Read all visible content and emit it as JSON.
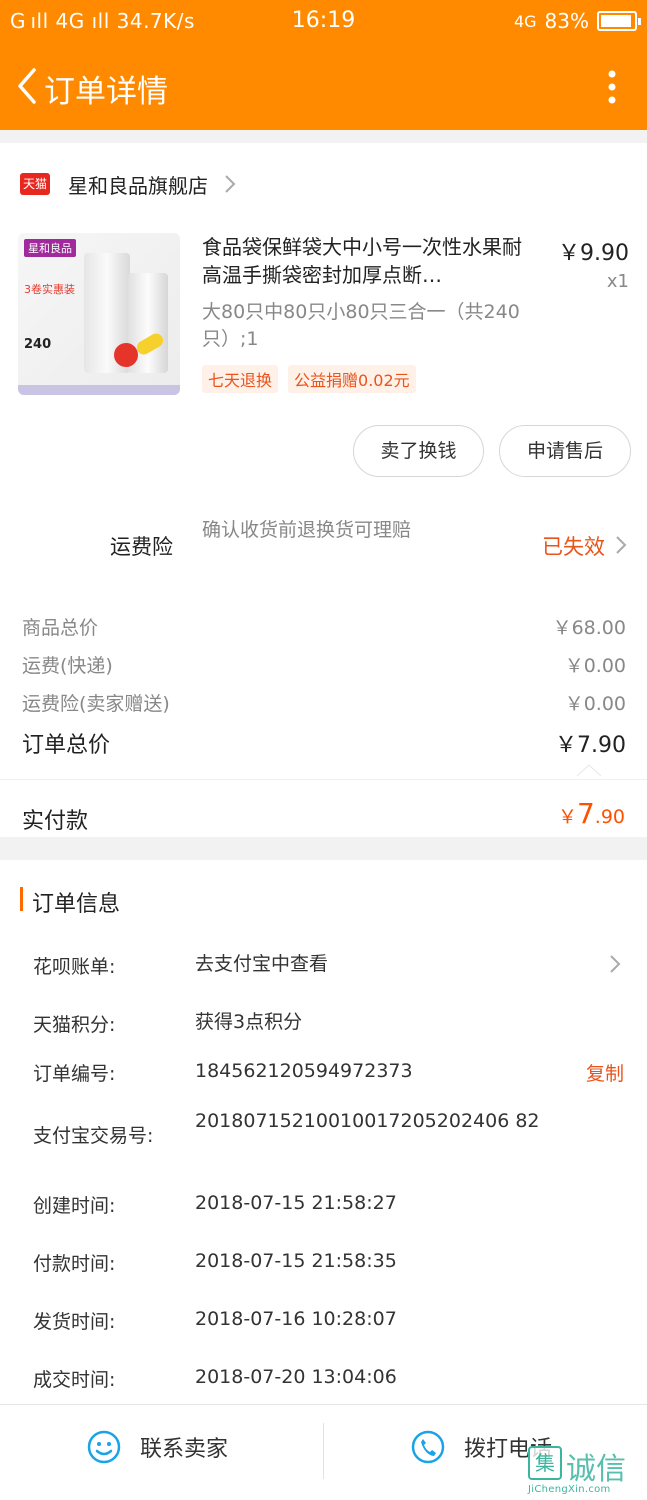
{
  "status_bar": {
    "left": "G ıll 4G ıll 34.7K/s",
    "time": "16:19",
    "network": "4G",
    "battery": "83%",
    "battery_level": 0.83
  },
  "header": {
    "title": "订单详情"
  },
  "shop": {
    "badge": "天猫",
    "name": "星和良品旗舰店"
  },
  "product": {
    "image": {
      "brand": "星和良品",
      "badge": "3卷实惠装",
      "count": "240"
    },
    "title": "食品袋保鲜袋大中小号一次性水果耐高温手撕袋密封加厚点断…",
    "price": "￥9.90",
    "qty": "x1",
    "sku": "大80只中80只小80只三合一（共240只）;1",
    "tags": [
      "七天退换",
      "公益捐赠0.02元"
    ]
  },
  "actions": {
    "sell": "卖了换钱",
    "after_sale": "申请售后"
  },
  "freight_insurance": {
    "label": "运费险",
    "desc": "确认收货前退换货可理赔",
    "status": "已失效"
  },
  "costs": [
    {
      "label": "商品总价",
      "value": "￥68.00"
    },
    {
      "label": "运费(快递)",
      "value": "￥0.00"
    },
    {
      "label": "运费险(卖家赠送)",
      "value": "￥0.00"
    }
  ],
  "order_total": {
    "label": "订单总价",
    "value": "￥7.90"
  },
  "paid": {
    "label": "实付款",
    "currency": "￥",
    "int": "7",
    "dec": ".90"
  },
  "order_info": {
    "title": "订单信息",
    "rows": [
      {
        "key": "花呗账单:",
        "value": "去支付宝中查看"
      },
      {
        "key": "天猫积分:",
        "value": "获得3点积分"
      },
      {
        "key": "订单编号:",
        "value": "184562120594972373",
        "action": "复制"
      },
      {
        "key": "支付宝交易号:",
        "value": "20180715210010017205202406 82"
      },
      {
        "key": "创建时间:",
        "value": "2018-07-15 21:58:27"
      },
      {
        "key": "付款时间:",
        "value": "2018-07-15 21:58:35"
      },
      {
        "key": "发货时间:",
        "value": "2018-07-16 10:28:07"
      },
      {
        "key": "成交时间:",
        "value": "2018-07-20 13:04:06"
      }
    ]
  },
  "bottom_bar": {
    "contact": "联系卖家",
    "call": "拨打电话"
  },
  "watermark": {
    "mark": "集",
    "cn": "诚信",
    "en": "JiChengXin.com"
  },
  "colors": {
    "accent": "#ff8a00",
    "highlight": "#e8541c",
    "price_red": "#ff5000"
  }
}
